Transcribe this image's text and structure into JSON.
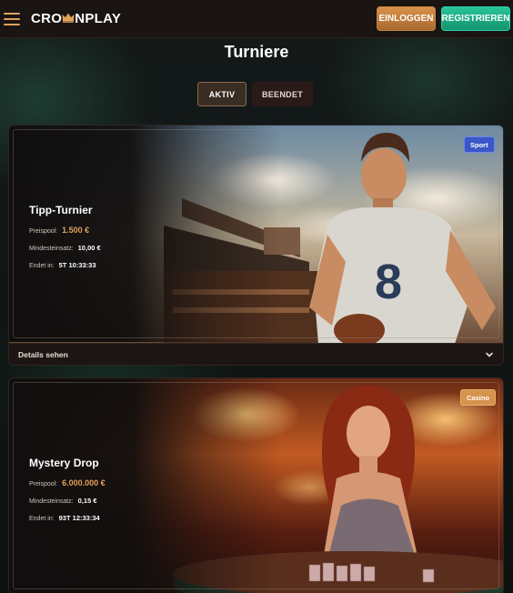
{
  "header": {
    "logo_text_before": "CRO",
    "logo_text_after": "NPLAY",
    "login_label": "EINLOGGEN",
    "register_label": "REGISTRIEREN"
  },
  "page": {
    "title": "Turniere"
  },
  "tabs": [
    {
      "label": "AKTIV",
      "active": true
    },
    {
      "label": "BEENDET",
      "active": false
    }
  ],
  "tournaments": [
    {
      "title": "Tipp-Turnier",
      "badge": "Sport",
      "prize_label": "Preispool:",
      "prize_value": "1.500 €",
      "min_bet_label": "Mindesteinsatz:",
      "min_bet_value": "10,00 €",
      "ends_label": "Endet in:",
      "ends_value": "5T 10:33:33",
      "details_label": "Details sehen"
    },
    {
      "title": "Mystery Drop",
      "badge": "Casino",
      "prize_label": "Preispool:",
      "prize_value": "6.000.000 €",
      "min_bet_label": "Mindesteinsatz:",
      "min_bet_value": "0,15 €",
      "ends_label": "Endet in:",
      "ends_value": "93T 12:33:34"
    }
  ],
  "colors": {
    "accent_gold": "#e0a25a",
    "register_green": "#1fae85",
    "sport_badge": "#3a56c8",
    "casino_badge": "#d5934c"
  }
}
